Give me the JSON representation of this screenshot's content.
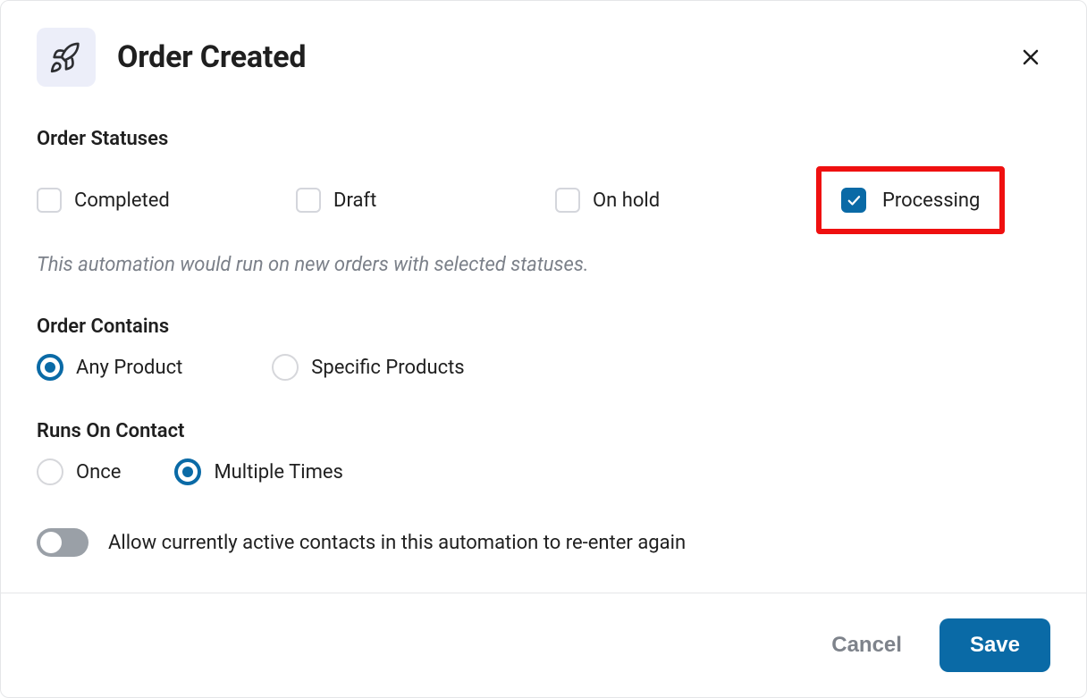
{
  "header": {
    "title": "Order Created"
  },
  "statuses": {
    "label": "Order Statuses",
    "items": [
      {
        "label": "Completed",
        "checked": false
      },
      {
        "label": "Draft",
        "checked": false
      },
      {
        "label": "On hold",
        "checked": false
      },
      {
        "label": "Processing",
        "checked": true,
        "highlighted": true
      }
    ],
    "help": "This automation would run on new orders with selected statuses."
  },
  "contains": {
    "label": "Order Contains",
    "options": [
      {
        "label": "Any Product",
        "selected": true
      },
      {
        "label": "Specific Products",
        "selected": false
      }
    ]
  },
  "runs": {
    "label": "Runs On Contact",
    "options": [
      {
        "label": "Once",
        "selected": false
      },
      {
        "label": "Multiple Times",
        "selected": true
      }
    ]
  },
  "reenter": {
    "label": "Allow currently active contacts in this automation to re-enter again",
    "on": false
  },
  "footer": {
    "cancel": "Cancel",
    "save": "Save"
  }
}
